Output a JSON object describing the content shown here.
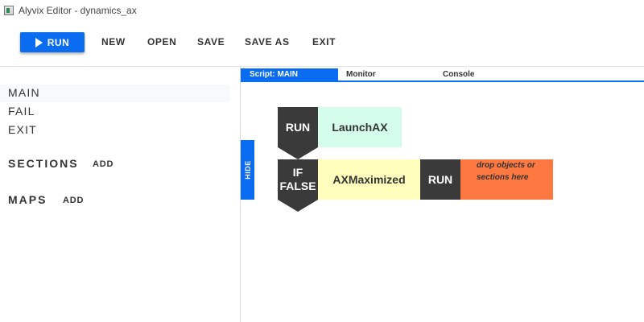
{
  "window": {
    "title": "Alyvix Editor - dynamics_ax"
  },
  "toolbar": {
    "run_label": "RUN",
    "new_label": "NEW",
    "open_label": "OPEN",
    "save_label": "SAVE",
    "save_as_label": "SAVE AS",
    "exit_label": "EXIT"
  },
  "sidebar": {
    "scripts": [
      {
        "label": "MAIN",
        "active": true
      },
      {
        "label": "FAIL",
        "active": false
      },
      {
        "label": "EXIT",
        "active": false
      }
    ],
    "sections_heading": "SECTIONS",
    "sections_add": "ADD",
    "maps_heading": "MAPS",
    "maps_add": "ADD"
  },
  "hide_tab": {
    "label": "HIDE"
  },
  "tabs": [
    {
      "label": "Script: MAIN",
      "active": true
    },
    {
      "label": "Monitor",
      "active": false
    },
    {
      "label": "Console",
      "active": false
    }
  ],
  "script": {
    "row1": {
      "keyword": "RUN",
      "object": "LaunchAX"
    },
    "row2": {
      "keyword_line1": "IF",
      "keyword_line2": "FALSE",
      "object": "AXMaximized",
      "inner_keyword": "RUN",
      "drop_line1": "drop objects or",
      "drop_line2": "sections here"
    }
  },
  "colors": {
    "accent": "#0a6cf0",
    "keyword_block": "#3a3a3a",
    "object_run": "#d4fdec",
    "object_if": "#fefdbc",
    "drop_zone": "#fe7841"
  }
}
